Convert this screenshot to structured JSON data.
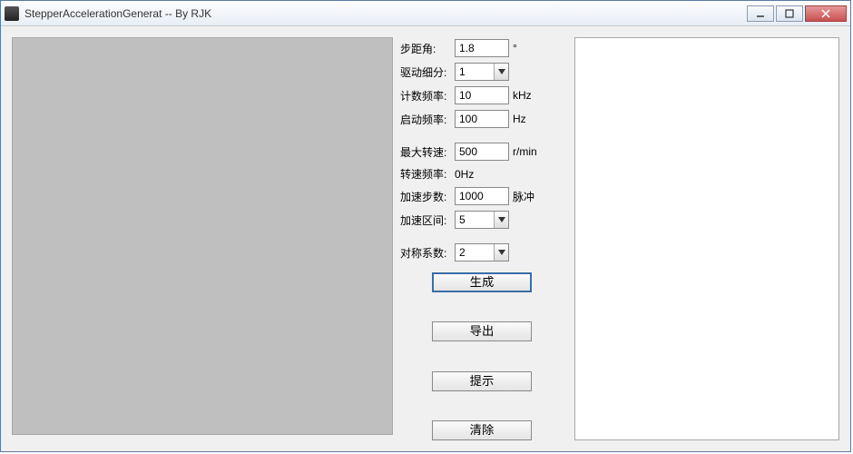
{
  "title": "StepperAccelerationGenerat -- By RJK",
  "fields": {
    "step_angle": {
      "label": "步距角:",
      "value": "1.8",
      "unit": "°"
    },
    "drive_div": {
      "label": "驱动细分:",
      "value": "1",
      "unit": ""
    },
    "count_freq": {
      "label": "计数频率:",
      "value": "10",
      "unit": "kHz"
    },
    "start_freq": {
      "label": "启动频率:",
      "value": "100",
      "unit": "Hz"
    },
    "max_rpm": {
      "label": "最大转速:",
      "value": "500",
      "unit": "r/min"
    },
    "rpm_freq": {
      "label": "转速频率:",
      "value": "0Hz"
    },
    "accel_steps": {
      "label": "加速步数:",
      "value": "1000",
      "unit": "脉冲"
    },
    "accel_range": {
      "label": "加速区间:",
      "value": "5",
      "unit": ""
    },
    "sym_factor": {
      "label": "对称系数:",
      "value": "2",
      "unit": ""
    }
  },
  "buttons": {
    "generate": "生成",
    "export": "导出",
    "hint": "提示",
    "clear": "清除"
  }
}
